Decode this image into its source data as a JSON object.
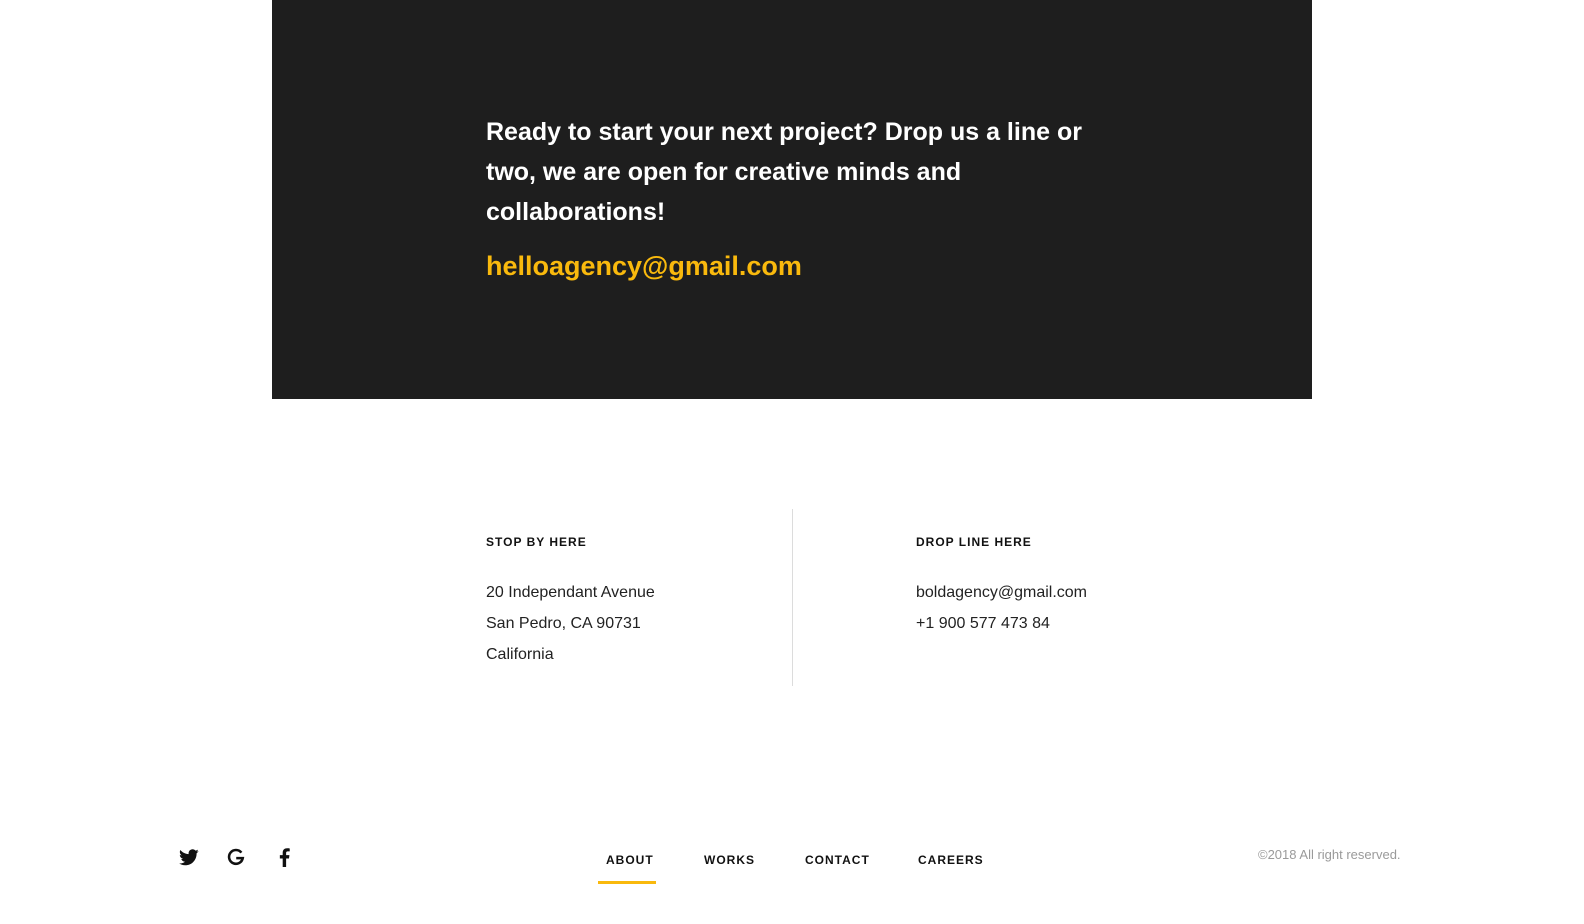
{
  "cta": {
    "message": "Ready to start your next project? Drop us a line or two, we are open for creative minds and collaborations!",
    "email": "helloagency@gmail.com"
  },
  "stop_by": {
    "heading": "STOP BY HERE",
    "lines": [
      "20 Independant Avenue",
      "San Pedro, CA 90731",
      "California"
    ]
  },
  "drop_line": {
    "heading": "DROP LINE HERE",
    "lines": [
      "boldagency@gmail.com",
      "+1 900 577 473 84"
    ]
  },
  "social": {
    "icons": [
      "twitter-icon",
      "google-icon",
      "facebook-icon"
    ]
  },
  "nav": {
    "items": [
      "ABOUT",
      "WORKS",
      "CONTACT",
      "CAREERS"
    ],
    "active": "ABOUT"
  },
  "footer": {
    "copyright": "©2018 All right reserved."
  },
  "colors": {
    "accent": "#f9b90d",
    "dark_block": "#1e1e1e",
    "text": "#111111",
    "muted": "#9a9a9a"
  }
}
